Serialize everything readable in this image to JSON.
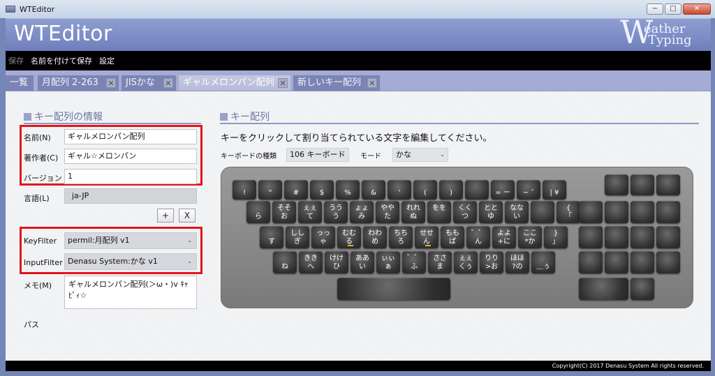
{
  "window": {
    "title": "WTEditor",
    "minimize": "−",
    "maximize": "□",
    "close": "✕"
  },
  "header": {
    "app_title": "WTEditor",
    "logo_big": "W",
    "logo_line1": "eather",
    "logo_line2": "Typing"
  },
  "menu": {
    "items": [
      "保存",
      "名前を付けて保存",
      "設定"
    ]
  },
  "tabs": [
    {
      "label": "一覧",
      "closable": false
    },
    {
      "label": "月配列 2-263",
      "closable": true
    },
    {
      "label": "JISかな",
      "closable": true
    },
    {
      "label": "ギャルメロンパン配列",
      "closable": true,
      "active": true
    },
    {
      "label": "新しいキー配列",
      "closable": true
    }
  ],
  "tab_close_glyph": "✕",
  "info": {
    "section_title": "キー配列の情報",
    "name_label": "名前(N)",
    "name_value": "ギャルメロンパン配列",
    "author_label": "著作者(C)",
    "author_value": "ギャル☆メロンパン",
    "version_label": "バージョン(",
    "version_value": "1",
    "lang_label": "言語(L)",
    "lang_value": "ja-JP",
    "add_button": "+",
    "remove_button": "X",
    "keyfilter_label": "KeyFilter",
    "keyfilter_value": "permil:月配列 v1",
    "inputfilter_label": "InputFilter",
    "inputfilter_value": "Denasu System:かな v1",
    "memo_label": "メモ(M)",
    "memo_value": "ギャルメロンパン配列(＞ω・)v ｷｬﾋﾟｨ☆",
    "path_label": "パス"
  },
  "keyboard": {
    "section_title": "キー配列",
    "instructions": "キーをクリックして割り当てられている文字を編集してください。",
    "type_label": "キーボードの種類",
    "type_value": "106 キーボード",
    "mode_label": "モード",
    "mode_value": "かな",
    "chevron": "⌄",
    "rows": [
      [
        [
          "!",
          ""
        ],
        [
          "\"",
          ""
        ],
        [
          "#",
          ""
        ],
        [
          "$",
          ""
        ],
        [
          "%",
          ""
        ],
        [
          "&",
          ""
        ],
        [
          "'",
          ""
        ],
        [
          "(",
          ""
        ],
        [
          ")",
          ""
        ],
        [
          "",
          ""
        ],
        [
          "=",
          ""
        ],
        [
          "~",
          ""
        ],
        [
          "|",
          ""
        ]
      ],
      [
        [
          "そそ",
          "お"
        ],
        [
          "ぇぇ",
          "て"
        ],
        [
          "うう",
          "う"
        ],
        [
          "ょょ",
          "み"
        ],
        [
          "やや",
          "た"
        ],
        [
          "れれ",
          "ぬ"
        ],
        [
          "をを",
          ""
        ],
        [
          "くく",
          "つ"
        ],
        [
          "とと",
          "ゆ"
        ],
        [
          "なな",
          "い"
        ],
        [
          "",
          ""
        ],
        [
          "",
          "「"
        ]
      ],
      [
        [
          "しし",
          "ぎ"
        ],
        [
          "っっ",
          "ゃ"
        ],
        [
          "むむ",
          "る"
        ],
        [
          "わわ",
          "め"
        ],
        [
          "ちち",
          "ろ"
        ],
        [
          "せせ",
          "ん"
        ],
        [
          "もも",
          "ぱ"
        ],
        [
          "゜゜",
          "ん"
        ],
        [
          "よよ",
          "+に"
        ],
        [
          "ここ",
          "*か"
        ],
        [
          "",
          "」"
        ]
      ],
      [
        [
          "きき",
          "へ"
        ],
        [
          "けけ",
          "ひ"
        ],
        [
          "ああ",
          "い"
        ],
        [
          "ぃぃ",
          "ぁ"
        ],
        [
          "゛゛",
          "ふ"
        ],
        [
          "ささ",
          "ま"
        ],
        [
          "ぇぇ",
          "くぅ"
        ],
        [
          "りり",
          ">お"
        ],
        [
          "ほほ",
          "?の"
        ],
        [
          "",
          "＿ぅ"
        ]
      ]
    ],
    "extra_keys": {
      "row1_minus": "ー",
      "row1_caret": "ˆ",
      "row1_yen": "¥",
      "row2_first": "ら",
      "row2_bracket_top": "{",
      "row3_first": "す",
      "row3_bracket_top": "}",
      "row4_first": "ね"
    },
    "colors": {
      "key_underline": "#e9b01a",
      "highlight_box": "#e3151b"
    }
  },
  "footer": {
    "copyright": "Copyright(C) 2017 Denasu System All rights reserved."
  }
}
